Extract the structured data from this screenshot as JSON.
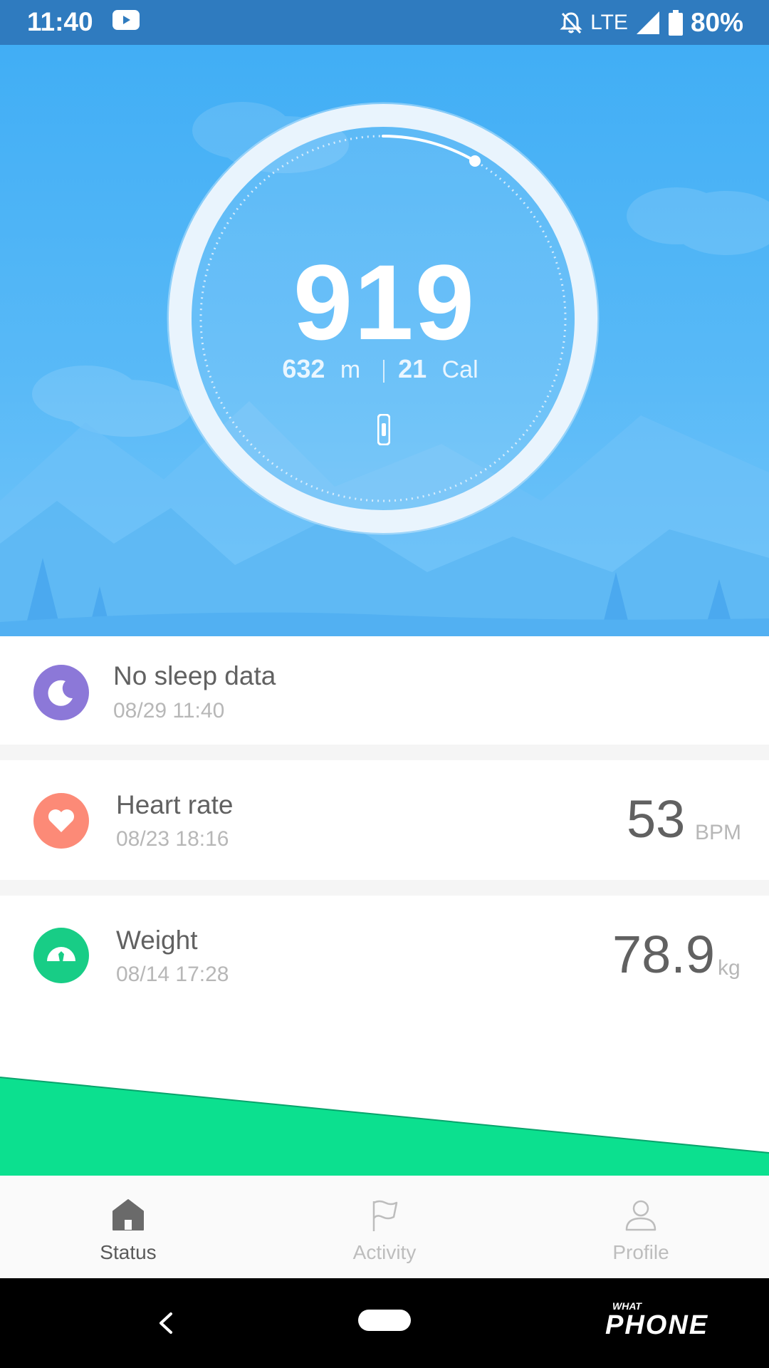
{
  "status_bar": {
    "time": "11:40",
    "network": "LTE",
    "battery": "80%"
  },
  "hero": {
    "steps": "919",
    "distance_value": "632",
    "distance_unit": "m",
    "calories_value": "21",
    "calories_unit": "Cal",
    "goal_progress": 0.09
  },
  "sleep": {
    "title": "No sleep data",
    "date": "08/29 11:40"
  },
  "heart_rate": {
    "title": "Heart rate",
    "date": "08/23 18:16",
    "value": "53",
    "unit": "BPM"
  },
  "weight": {
    "title": "Weight",
    "date": "08/14 17:28",
    "value": "78.9",
    "unit": "kg"
  },
  "nav": {
    "items": [
      {
        "label": "Status",
        "icon": "home-icon",
        "active": true
      },
      {
        "label": "Activity",
        "icon": "flag-icon",
        "active": false
      },
      {
        "label": "Profile",
        "icon": "person-icon",
        "active": false
      }
    ]
  },
  "watermark": {
    "text": "WHAT PHONE"
  },
  "colors": {
    "status_bar": "#2f7bbf",
    "hero_top": "#41aef5",
    "sleep_icon": "#8c78d8",
    "heart_icon": "#fc8a77",
    "weight_icon": "#18cd86",
    "chart_fill": "#0ce08f"
  }
}
